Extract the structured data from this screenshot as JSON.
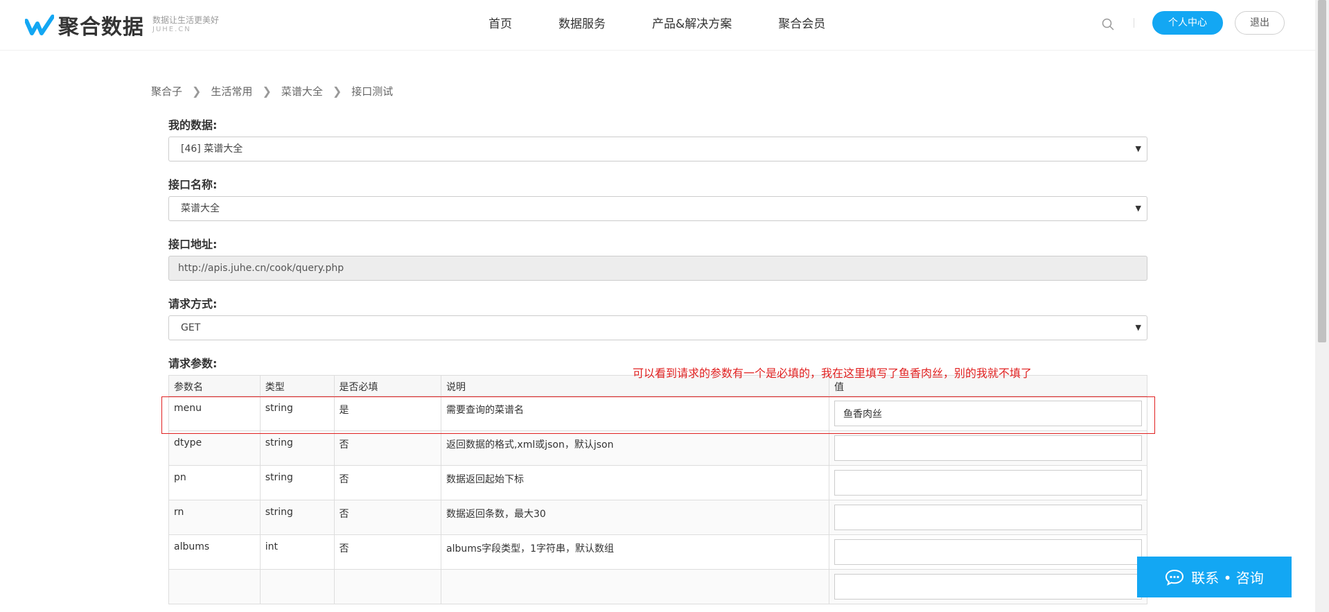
{
  "header": {
    "logo_text": "聚合数据",
    "slogan": "数据让生活更美好",
    "domain": "JUHE.CN",
    "nav": [
      "首页",
      "数据服务",
      "产品&解决方案",
      "聚合会员"
    ],
    "search_icon": "search-icon",
    "user_center": "个人中心",
    "logout": "退出",
    "accent": "#13a7f3"
  },
  "breadcrumb": [
    "聚合子",
    "生活常用",
    "菜谱大全",
    "接口测试"
  ],
  "form": {
    "my_data_label": "我的数据:",
    "my_data_value": "[46] 菜谱大全",
    "api_name_label": "接口名称:",
    "api_name_value": "菜谱大全",
    "api_url_label": "接口地址:",
    "api_url_value": "http://apis.juhe.cn/cook/query.php",
    "method_label": "请求方式:",
    "method_value": "GET",
    "params_label": "请求参数:"
  },
  "annotation": {
    "text": "可以看到请求的参数有一个是必填的，我在这里填写了鱼香肉丝，别的我就不填了",
    "color": "#e02020"
  },
  "params_table": {
    "headers": [
      "参数名",
      "类型",
      "是否必填",
      "说明",
      "值"
    ],
    "rows": [
      {
        "name": "menu",
        "type": "string",
        "required": "是",
        "desc": "需要查询的菜谱名",
        "value": "鱼香肉丝"
      },
      {
        "name": "dtype",
        "type": "string",
        "required": "否",
        "desc": "返回数据的格式,xml或json，默认json",
        "value": ""
      },
      {
        "name": "pn",
        "type": "string",
        "required": "否",
        "desc": "数据返回起始下标",
        "value": ""
      },
      {
        "name": "rn",
        "type": "string",
        "required": "否",
        "desc": "数据返回条数，最大30",
        "value": ""
      },
      {
        "name": "albums",
        "type": "int",
        "required": "否",
        "desc": "albums字段类型，1字符串，默认数组",
        "value": ""
      },
      {
        "name": "",
        "type": "",
        "required": "",
        "desc": "",
        "value": ""
      }
    ]
  },
  "contact": {
    "label": "联系 • 咨询",
    "icon": "chat-icon"
  }
}
